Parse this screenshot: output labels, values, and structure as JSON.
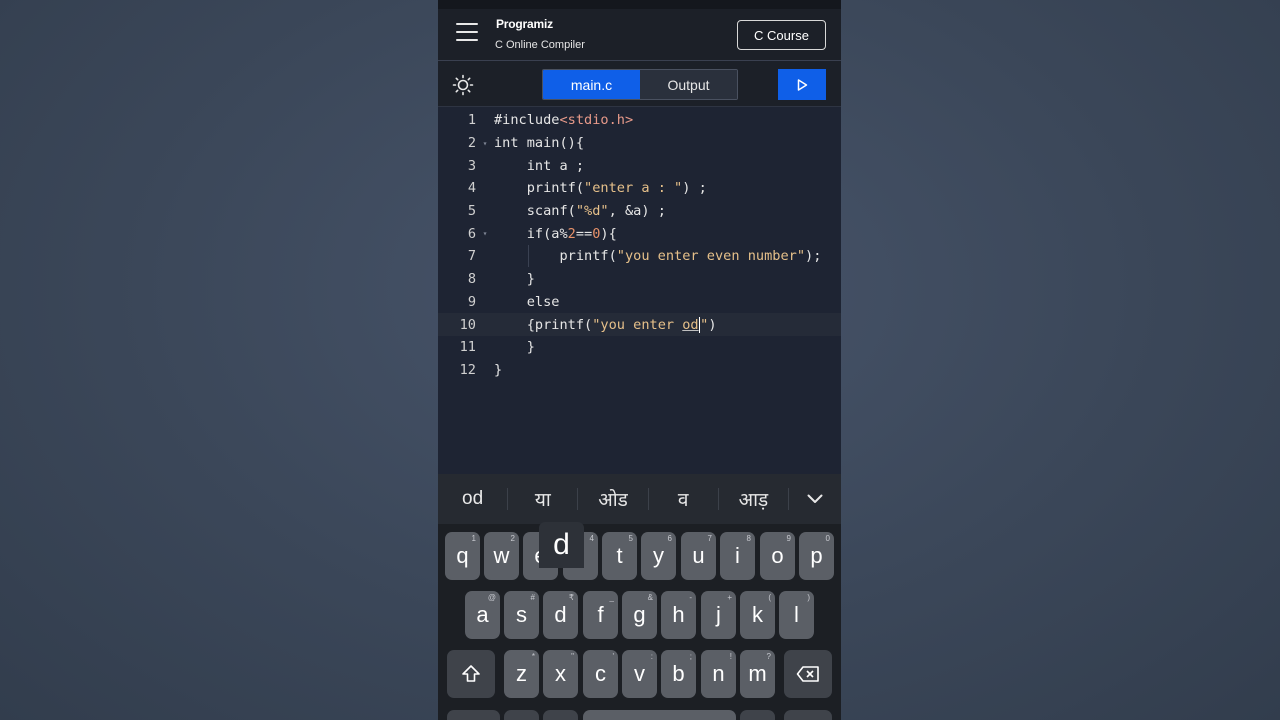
{
  "header": {
    "logo": "Programiz",
    "subtitle": "C Online Compiler",
    "course_button": "C Course"
  },
  "toolbar": {
    "tabs": [
      {
        "label": "main.c",
        "active": true
      },
      {
        "label": "Output",
        "active": false
      }
    ],
    "run_icon": "play-icon",
    "theme_icon": "sun-icon"
  },
  "editor": {
    "lines": [
      {
        "n": "1",
        "fold": ""
      },
      {
        "n": "2",
        "fold": "▾"
      },
      {
        "n": "3",
        "fold": ""
      },
      {
        "n": "4",
        "fold": ""
      },
      {
        "n": "5",
        "fold": ""
      },
      {
        "n": "6",
        "fold": "▾"
      },
      {
        "n": "7",
        "fold": ""
      },
      {
        "n": "8",
        "fold": ""
      },
      {
        "n": "9",
        "fold": ""
      },
      {
        "n": "10",
        "fold": ""
      },
      {
        "n": "11",
        "fold": ""
      },
      {
        "n": "12",
        "fold": ""
      }
    ],
    "code": {
      "l1_a": "#include",
      "l1_b": "<stdio.h>",
      "l2": "int main(){",
      "l3": "    int a ;",
      "l4_a": "    printf(",
      "l4_b": "\"enter a : \"",
      "l4_c": ") ;",
      "l5_a": "    scanf(",
      "l5_b": "\"%d\"",
      "l5_c": ", &a) ;",
      "l6_a": "    if(a%",
      "l6_b": "2",
      "l6_c": "==",
      "l6_d": "0",
      "l6_e": "){",
      "l7_a": "        printf(",
      "l7_b": "\"you enter even number\"",
      "l7_c": ");",
      "l8": "    }",
      "l9": "    else",
      "l10_a": "    {printf(",
      "l10_b": "\"you enter ",
      "l10_word": "od",
      "l10_c": "\"",
      "l10_d": ")",
      "l11": "    }",
      "l12": "}"
    },
    "colors": {
      "string": "#e6c08a",
      "number": "#e8926a",
      "include": "#e89a8a",
      "text": "#e6e6e6"
    }
  },
  "keyboard": {
    "suggestions": [
      "od",
      "या",
      "ओड",
      "व",
      "आड़"
    ],
    "collapse_icon": "chevron-down-icon",
    "row1": [
      {
        "k": "q",
        "h": "1"
      },
      {
        "k": "w",
        "h": "2"
      },
      {
        "k": "e",
        "h": "3"
      },
      {
        "k": "r",
        "h": "4"
      },
      {
        "k": "t",
        "h": "5"
      },
      {
        "k": "y",
        "h": "6"
      },
      {
        "k": "u",
        "h": "7"
      },
      {
        "k": "i",
        "h": "8"
      },
      {
        "k": "o",
        "h": "9"
      },
      {
        "k": "p",
        "h": "0"
      }
    ],
    "row2": [
      {
        "k": "a",
        "h": "@"
      },
      {
        "k": "s",
        "h": "#"
      },
      {
        "k": "d",
        "h": "₹"
      },
      {
        "k": "f",
        "h": "_"
      },
      {
        "k": "g",
        "h": "&"
      },
      {
        "k": "h",
        "h": "-"
      },
      {
        "k": "j",
        "h": "+"
      },
      {
        "k": "k",
        "h": "("
      },
      {
        "k": "l",
        "h": ")"
      }
    ],
    "row3": [
      {
        "k": "z",
        "h": "*"
      },
      {
        "k": "x",
        "h": "\""
      },
      {
        "k": "c",
        "h": "'"
      },
      {
        "k": "v",
        "h": ":"
      },
      {
        "k": "b",
        "h": ";"
      },
      {
        "k": "n",
        "h": "!"
      },
      {
        "k": "m",
        "h": "?"
      }
    ],
    "popup_key": "d",
    "shift_icon": "shift-icon",
    "backspace_icon": "backspace-icon"
  }
}
